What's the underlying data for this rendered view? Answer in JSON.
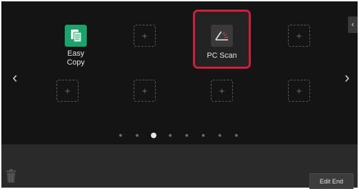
{
  "home": {
    "tiles": [
      {
        "label": "Easy\nCopy",
        "icon": "easy-copy-icon",
        "type": "app"
      },
      {
        "label": "",
        "icon": "add-slot-icon",
        "type": "empty"
      },
      {
        "label": "PC Scan",
        "icon": "pc-scan-icon",
        "type": "app",
        "selected": true
      },
      {
        "label": "",
        "icon": "add-slot-icon",
        "type": "empty"
      },
      {
        "label": "",
        "icon": "add-slot-icon",
        "type": "empty"
      },
      {
        "label": "",
        "icon": "add-slot-icon",
        "type": "empty"
      },
      {
        "label": "",
        "icon": "add-slot-icon",
        "type": "empty"
      },
      {
        "label": "",
        "icon": "add-slot-icon",
        "type": "empty"
      }
    ],
    "plus_glyph": "+",
    "nav": {
      "prev": "‹",
      "next": "›",
      "collapse": "‹"
    },
    "pager": {
      "pages": 8,
      "current_page": 3
    }
  },
  "bottom_bar": {
    "edit_end_label": "Edit End",
    "trash_icon": "trash-icon"
  },
  "colors": {
    "highlight": "#d21f3c",
    "easy_copy_accent": "#1aa36a",
    "background": "#141414"
  }
}
